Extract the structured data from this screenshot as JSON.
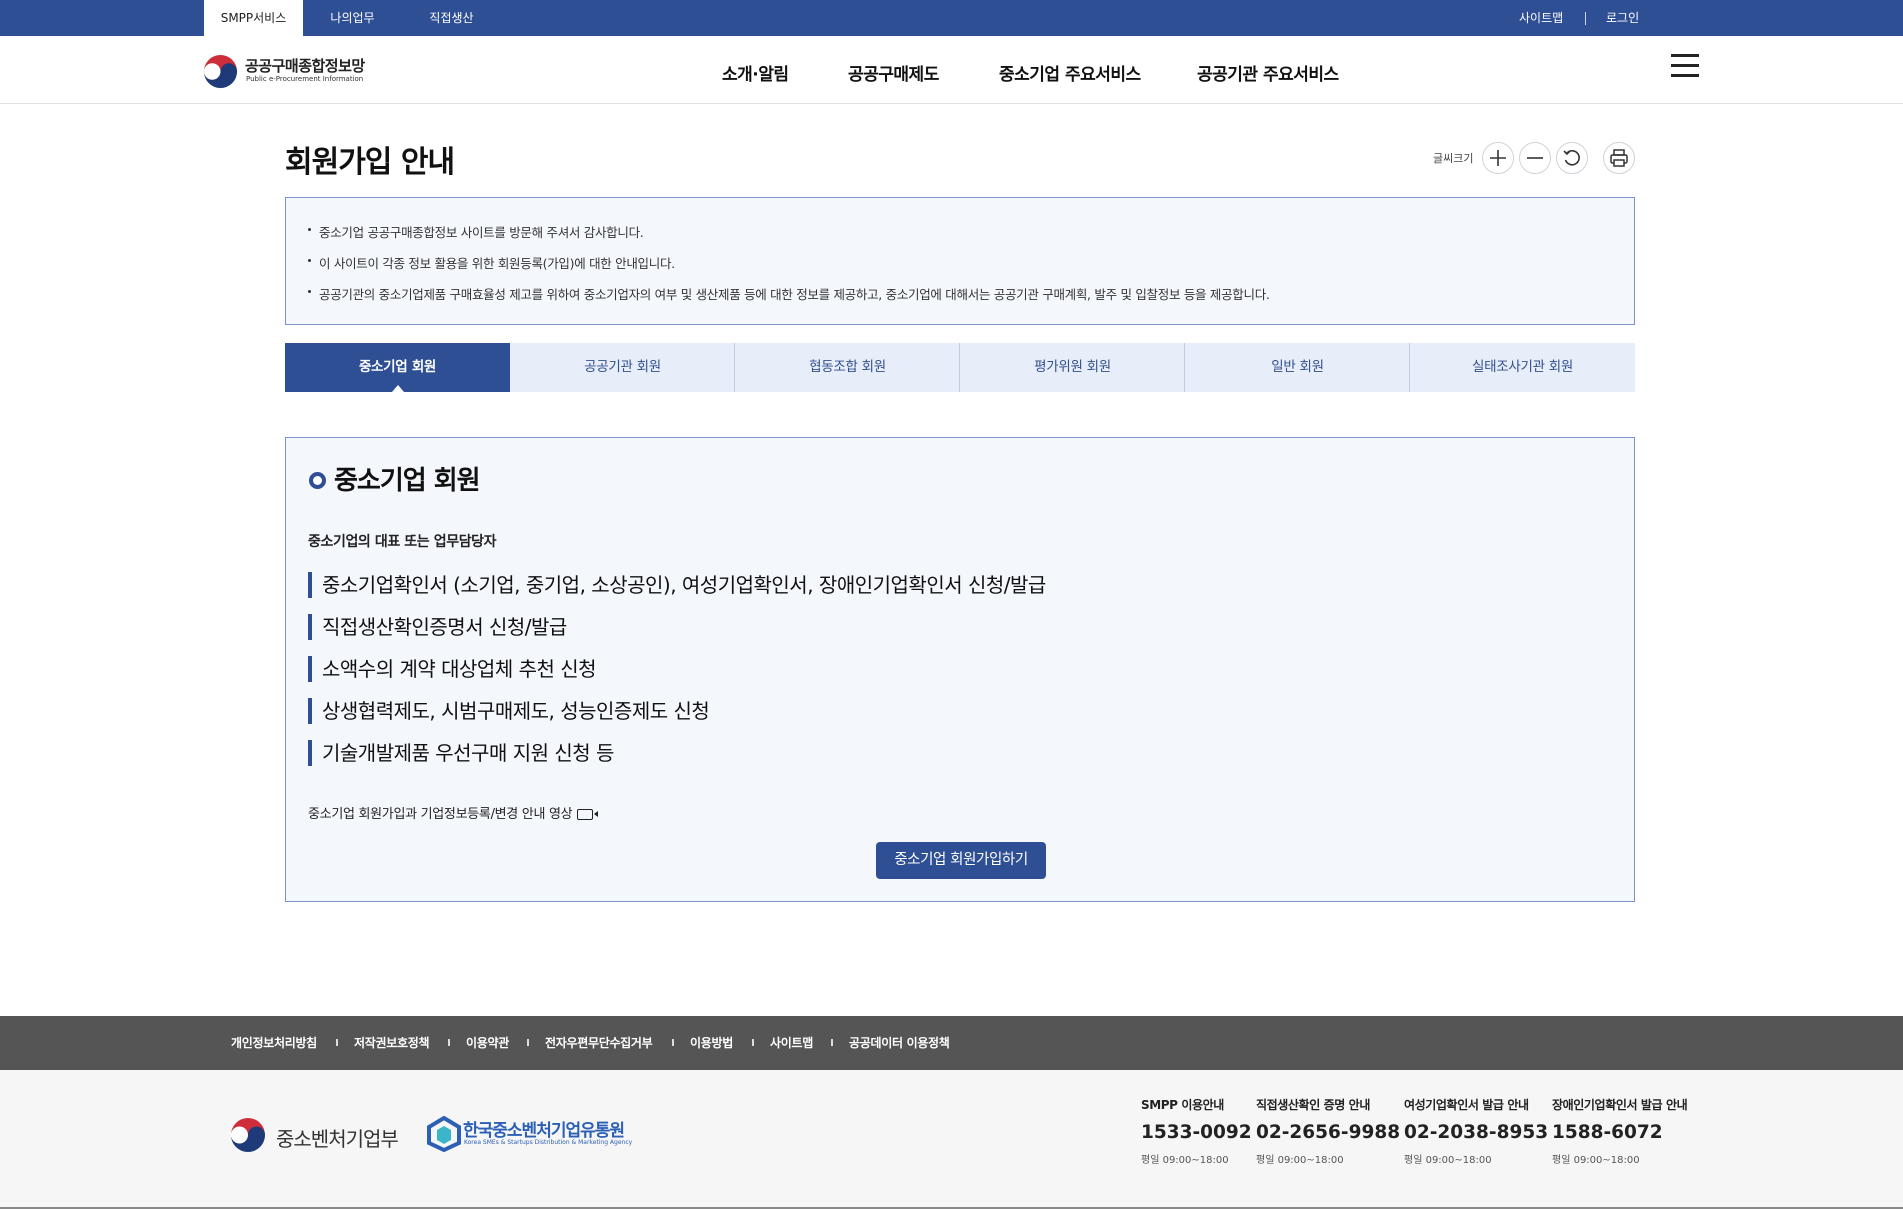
{
  "topbar": {
    "tabs": [
      "SMPP서비스",
      "나의업무",
      "직접생산"
    ],
    "util": [
      "사이트맵",
      "로그인"
    ]
  },
  "header": {
    "logo_title": "공공구매종합정보망",
    "logo_sub": "Public e-Procurement Information",
    "nav": [
      "소개·알림",
      "공공구매제도",
      "중소기업 주요서비스",
      "공공기관 주요서비스"
    ]
  },
  "page": {
    "title": "회원가입 안내",
    "font_size_label": "글씨크기"
  },
  "notice": [
    "중소기업 공공구매종합정보 사이트를 방문해 주셔서 감사합니다.",
    "이 사이트이 각종 정보 활용을 위한 회원등록(가입)에 대한 안내입니다.",
    "공공기관의 중소기업제품 구매효율성 제고를 위하여 중소기업자의 여부 및 생산제품 등에 대한 정보를 제공하고, 중소기업에 대해서는 공공기관 구매계획, 발주 및 입찰정보 등을 제공합니다."
  ],
  "member_tabs": [
    "중소기업 회원",
    "공공기관 회원",
    "협동조합 회원",
    "평가위원 회원",
    "일반 회원",
    "실태조사기관 회원"
  ],
  "section": {
    "title": "중소기업 회원",
    "who": "중소기업의 대표 또는 업무담당자",
    "items": [
      "중소기업확인서 (소기업, 중기업, 소상공인), 여성기업확인서, 장애인기업확인서 신청/발급",
      "직접생산확인증명서 신청/발급",
      "소액수의 계약 대상업체 추천 신청",
      "상생협력제도, 시범구매제도, 성능인증제도 신청",
      "기술개발제품 우선구매 지원 신청 등"
    ],
    "video_link": "중소기업 회원가입과 기업정보등록/변경 안내 영상",
    "join_button": "중소기업 회원가입하기"
  },
  "footer_nav": [
    "개인정보처리방침",
    "저작권보호정책",
    "이용약관",
    "전자우편무단수집거부",
    "이용방법",
    "사이트맵",
    "공공데이터 이용정책"
  ],
  "footer": {
    "org1": "중소벤처기업부",
    "org2": "한국중소벤처기업유통원",
    "org2_sub": "Korea SMEs & Startups Distribution & Marketing Agency",
    "contacts": [
      {
        "name": "SMPP 이용안내",
        "phone": "1533-0092",
        "hours": "평일 09:00~18:00"
      },
      {
        "name": "직접생산확인 증명 안내",
        "phone": "02-2656-9988",
        "hours": "평일 09:00~18:00"
      },
      {
        "name": "여성기업확인서 발급 안내",
        "phone": "02-2038-8953",
        "hours": "평일 09:00~18:00"
      },
      {
        "name": "장애인기업확인서 발급 안내",
        "phone": "1588-6072",
        "hours": "평일 09:00~18:00"
      }
    ]
  },
  "colors": {
    "primary": "#2f4f95",
    "tab_bg": "#e7edf9",
    "box_bg": "#f4f7fc",
    "footer_nav": "#555555"
  }
}
